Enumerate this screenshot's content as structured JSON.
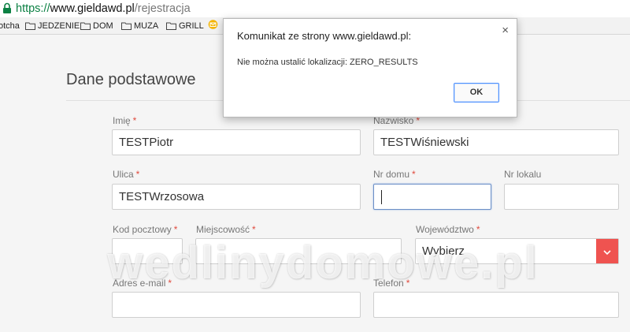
{
  "browser": {
    "url_protocol": "https://",
    "url_host": "www.gieldawd.pl",
    "url_path": "/rejestracja",
    "bookmarks": [
      {
        "label": "otcha",
        "icon": "none"
      },
      {
        "label": "JEDZENIE",
        "icon": "folder-icon"
      },
      {
        "label": "DOM",
        "icon": "folder-icon"
      },
      {
        "label": "MUZA",
        "icon": "folder-icon"
      },
      {
        "label": "GRILL",
        "icon": "folder-icon"
      },
      {
        "label": "",
        "icon": "mail-icon"
      }
    ]
  },
  "form": {
    "section_title": "Dane podstawowe",
    "required_mark": "*",
    "imie_label": "Imię",
    "imie_value": "TESTPiotr",
    "nazwisko_label": "Nazwisko",
    "nazwisko_value": "TESTWiśniewski",
    "ulica_label": "Ulica",
    "ulica_value": "TESTWrzosowa",
    "nr_domu_label": "Nr domu",
    "nr_domu_value": "",
    "nr_lokalu_label": "Nr lokalu",
    "nr_lokalu_value": "",
    "kod_label": "Kod pocztowy",
    "kod_value": "",
    "miejscowosc_label": "Miejscowość",
    "miejscowosc_value": "",
    "wojewodztwo_label": "Województwo",
    "wojewodztwo_value": "Wybierz",
    "email_label": "Adres e-mail",
    "email_value": "",
    "telefon_label": "Telefon",
    "telefon_value": ""
  },
  "watermark": "wedlinydomowe.pl",
  "dialog": {
    "title": "Komunikat ze strony www.gieldawd.pl:",
    "message": "Nie można ustalić lokalizacji: ZERO_RESULTS",
    "ok_label": "OK",
    "close_symbol": "×"
  },
  "colors": {
    "required": "#e04b3e",
    "select_button": "#ef5350",
    "https_green": "#0b8043",
    "focus_border": "#6b8fc7"
  }
}
